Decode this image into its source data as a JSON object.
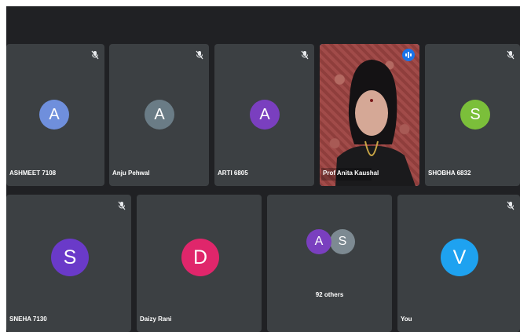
{
  "participants": [
    {
      "name": "ASHMEET 7108",
      "initial": "A",
      "color": "#6f8fdc",
      "muted": true
    },
    {
      "name": "Anju Pehwal",
      "initial": "A",
      "color": "#6a7c86",
      "muted": true
    },
    {
      "name": "ARTI 6805",
      "initial": "A",
      "color": "#7a3fbf",
      "muted": true
    },
    {
      "name": "Prof Anita Kaushal",
      "initial": "",
      "color": "",
      "muted": false,
      "video": true,
      "speaking": true
    },
    {
      "name": "SHOBHA 6832",
      "initial": "S",
      "color": "#7bbf3a",
      "muted": true
    },
    {
      "name": "SNEHA 7130",
      "initial": "S",
      "color": "#6a3ac9",
      "muted": true
    },
    {
      "name": "Daizy Rani",
      "initial": "D",
      "color": "#e0266b",
      "muted": false
    },
    {
      "name": "You",
      "initial": "V",
      "color": "#1ea2f0",
      "muted": true
    }
  ],
  "others_tile": {
    "label": "92 others",
    "avatars": [
      {
        "initial": "A",
        "color": "#7a3fbf"
      },
      {
        "initial": "S",
        "color": "#7d8a92"
      }
    ]
  },
  "icons": {
    "mute": "mic-off-icon",
    "speaking": "audio-level-icon"
  }
}
